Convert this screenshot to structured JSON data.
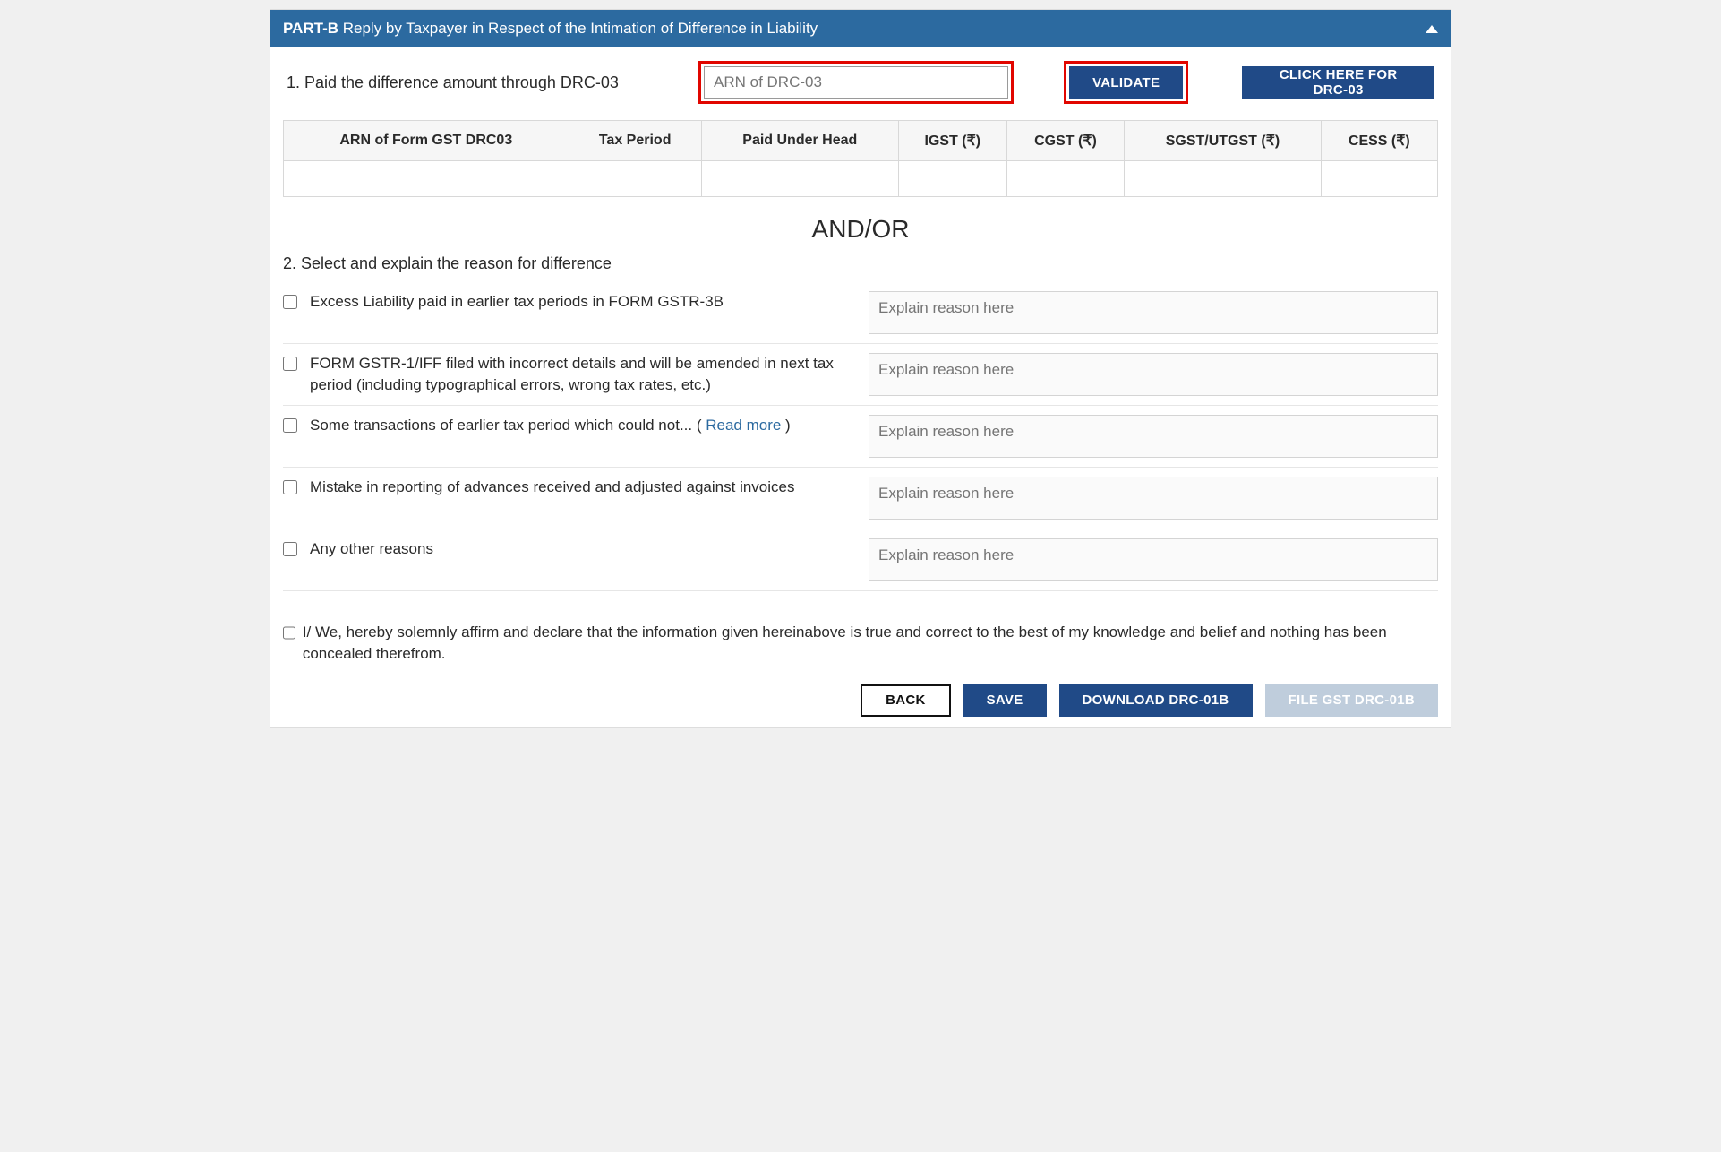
{
  "header": {
    "part": "PART-B",
    "title_rest": "Reply by Taxpayer in Respect of the Intimation of Difference in Liability"
  },
  "section1": {
    "label": "1. Paid the difference amount through DRC-03",
    "arn_placeholder": "ARN of DRC-03",
    "validate": "VALIDATE",
    "click_drc": "CLICK HERE FOR DRC-03"
  },
  "table": {
    "cols": {
      "c1": "ARN of Form GST DRC03",
      "c2": "Tax Period",
      "c3": "Paid Under Head",
      "c4": "IGST (₹)",
      "c5": "CGST (₹)",
      "c6": "SGST/UTGST (₹)",
      "c7": "CESS (₹)"
    }
  },
  "divider": "AND/OR",
  "section2": {
    "title": "2. Select and explain the reason for difference",
    "reasons": {
      "r1": "Excess Liability paid in earlier tax periods in FORM GSTR-3B",
      "r2": "FORM GSTR-1/IFF filed with incorrect details and will be amended in next tax period (including typographical errors, wrong tax rates, etc.)",
      "r3_pre": "Some transactions of earlier tax period which could not... ( ",
      "r3_link": "Read more",
      "r3_post": " )",
      "r4": "Mistake in reporting of advances received and adjusted against invoices",
      "r5": "Any other reasons"
    },
    "explain_placeholder": "Explain reason here"
  },
  "declaration": "I/ We, hereby solemnly affirm and declare that the information given hereinabove is true and correct to the best of my knowledge and belief and nothing has been concealed therefrom.",
  "footer": {
    "back": "BACK",
    "save": "SAVE",
    "download": "DOWNLOAD DRC-01B",
    "file": "FILE GST DRC-01B"
  }
}
